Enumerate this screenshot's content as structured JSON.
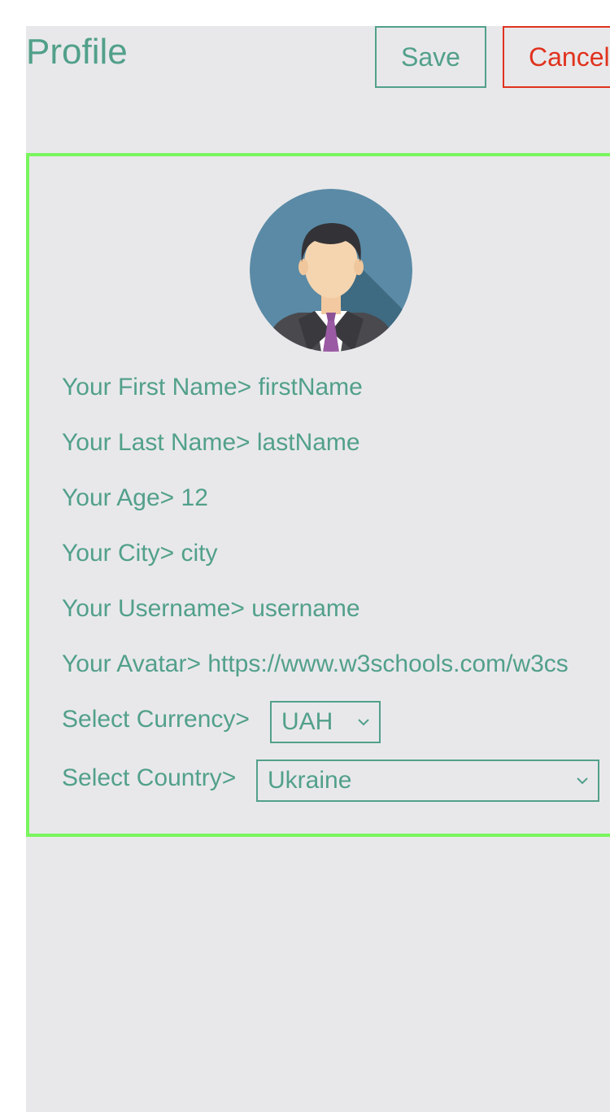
{
  "header": {
    "title": "Profile",
    "save_label": "Save",
    "cancel_label": "Cancel"
  },
  "profile": {
    "first_name": {
      "label": "Your First Name>",
      "value": "firstName"
    },
    "last_name": {
      "label": "Your Last Name>",
      "value": "lastName"
    },
    "age": {
      "label": "Your Age>",
      "value": "12"
    },
    "city": {
      "label": "Your City>",
      "value": "city"
    },
    "username": {
      "label": "Your Username>",
      "value": "username"
    },
    "avatar_url": {
      "label": "Your Avatar>",
      "value": "https://www.w3schools.com/w3cs"
    },
    "currency": {
      "label": "Select Currency>",
      "selected": "UAH"
    },
    "country": {
      "label": "Select Country>",
      "selected": "Ukraine"
    }
  },
  "colors": {
    "accent": "#52a08a",
    "cancel": "#e0321e",
    "card_border": "#79f55e",
    "background": "#e8e8ea"
  }
}
